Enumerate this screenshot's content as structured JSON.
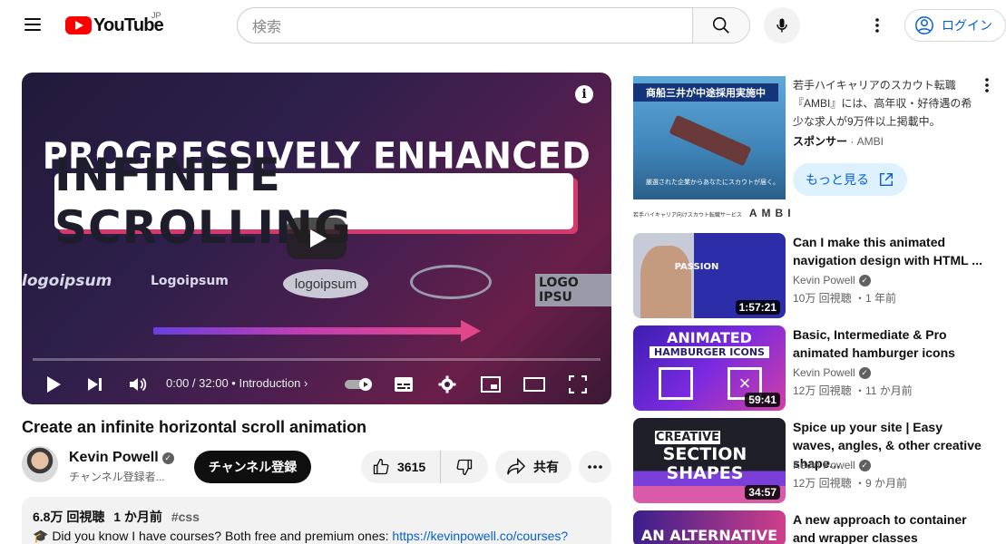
{
  "header": {
    "logo_text": "YouTube",
    "region": "JP",
    "search_placeholder": "検索",
    "login_label": "ログイン"
  },
  "player": {
    "thumb_line1": "PROGRESSIVELY ENHANCED",
    "thumb_line2": "INFINITE SCROLLING",
    "logos": [
      "logoipsum",
      "Logoipsum",
      "logoipsum",
      "LOGO IPSU"
    ],
    "time": "0:00 / 32:00",
    "chapter": "Introduction",
    "progress": 0
  },
  "video": {
    "title": "Create an infinite horizontal scroll animation",
    "channel_name": "Kevin Powell",
    "channel_subs": "チャンネル登録者...",
    "subscribe_label": "チャンネル登録",
    "like_count": "3615",
    "share_label": "共有"
  },
  "description": {
    "views": "6.8万 回視聴",
    "date": "1 か月前",
    "tag": "#css",
    "line": "🎓 Did you know I have courses? Both free and premium ones: ",
    "link": "https://kevinpowell.co/courses?"
  },
  "ad": {
    "banner_text": "商船三井が中途採用実施中",
    "banner_sub": "厳選された企業からあなたにスカウトが届く。",
    "foot_text": "若手ハイキャリア向けスカウト転職サービス",
    "foot_brand": "AMBI",
    "title": "若手ハイキャリアのスカウト転職『AMBI』には、高年収・好待遇の希少な求人が9万件以上掲載中。",
    "sponsor_label": "スポンサー",
    "sponsor_name": " · AMBI",
    "more_label": "もっと見る"
  },
  "recommendations": [
    {
      "title": "Can I make this animated navigation design with HTML ...",
      "channel": "Kevin Powell",
      "meta": "10万 回視聴 ・1 年前",
      "duration": "1:57:21",
      "thumb_text": "PASSION"
    },
    {
      "title": "Basic, Intermediate & Pro animated hamburger icons",
      "channel": "Kevin Powell",
      "meta": "12万 回視聴 ・11 か月前",
      "duration": "59:41",
      "thumb_text": "ANIMATED",
      "thumb_text2": "HAMBURGER ICONS"
    },
    {
      "title": "Spice up your site | Easy waves, angles, & other creative shape...",
      "channel": "Kevin Powell",
      "meta": "12万 回視聴 ・9 か月前",
      "duration": "34:57",
      "thumb_text": "CREATIVE",
      "thumb_text2": "SECTION SHAPES"
    },
    {
      "title": "A new approach to container and wrapper classes",
      "thumb_text": "AN ALTERNATIVE"
    }
  ]
}
